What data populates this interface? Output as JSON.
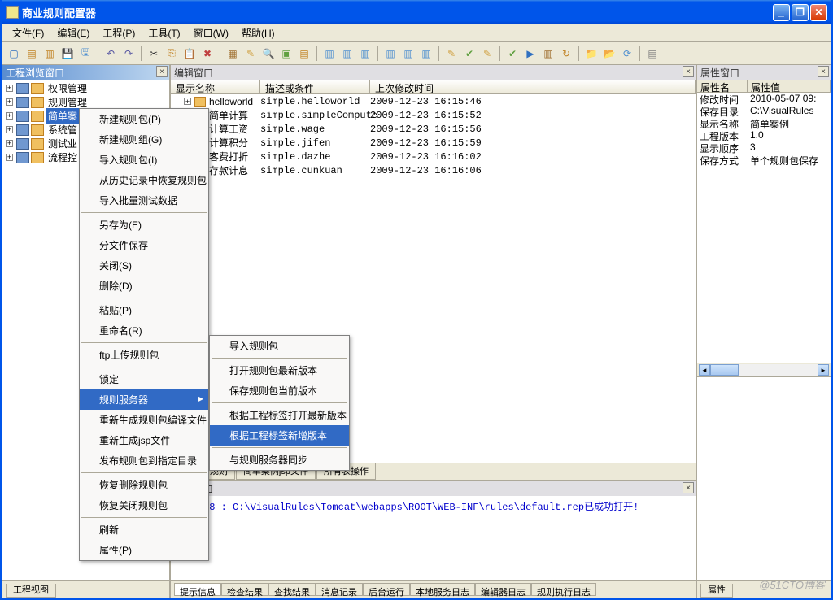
{
  "title": "商业规则配置器",
  "menu": [
    "文件(F)",
    "编辑(E)",
    "工程(P)",
    "工具(T)",
    "窗口(W)",
    "帮助(H)"
  ],
  "panels": {
    "left": "工程浏览窗口",
    "center": "编辑窗口",
    "right": "属性窗口",
    "msg": "消息窗口"
  },
  "tree": [
    {
      "label": "权限管理"
    },
    {
      "label": "规则管理"
    },
    {
      "label": "简单案",
      "selected": true
    },
    {
      "label": "系统管"
    },
    {
      "label": "测试业"
    },
    {
      "label": "流程控"
    }
  ],
  "table_cols": [
    "显示名称",
    "描述或条件",
    "上次修改时间"
  ],
  "table_rows": [
    {
      "name": "helloworld",
      "desc": "simple.helloworld",
      "time": "2009-12-23 16:15:46"
    },
    {
      "name": "简单计算",
      "desc": "simple.simpleCompute",
      "time": "2009-12-23 16:15:52"
    },
    {
      "name": "计算工资",
      "desc": "simple.wage",
      "time": "2009-12-23 16:15:56"
    },
    {
      "name": "计算积分",
      "desc": "simple.jifen",
      "time": "2009-12-23 16:15:59"
    },
    {
      "name": "客费打折",
      "desc": "simple.dazhe",
      "time": "2009-12-23 16:16:02"
    },
    {
      "name": "存款计息",
      "desc": "simple.cunkuan",
      "time": "2009-12-23 16:16:06"
    }
  ],
  "prop_cols": [
    "属性名",
    "属性值"
  ],
  "props": [
    {
      "n": "修改时间",
      "v": "2010-05-07 09:"
    },
    {
      "n": "保存目录",
      "v": "C:\\VisualRules"
    },
    {
      "n": "显示名称",
      "v": "简单案例"
    },
    {
      "n": "工程版本",
      "v": "1.0"
    },
    {
      "n": "显示顺序",
      "v": "3"
    },
    {
      "n": "保存方式",
      "v": "单个规则包保存"
    }
  ],
  "btabs": [
    "所有规则",
    "简单案例jsp文件",
    "所有表操作"
  ],
  "prop_btab": "属性",
  "left_btab": "工程视图",
  "msg_text": "9:11:28 : C:\\VisualRules\\Tomcat\\webapps\\ROOT\\WEB-INF\\rules\\default.rep已成功打开!",
  "msg_tabs": [
    "提示信息",
    "检查结果",
    "查找结果",
    "消息记录",
    "后台运行",
    "本地服务日志",
    "编辑器日志",
    "规则执行日志"
  ],
  "ctx1": [
    {
      "t": "新建规则包(P)"
    },
    {
      "t": "新建规则组(G)"
    },
    {
      "t": "导入规则包(I)"
    },
    {
      "t": "从历史记录中恢复规则包"
    },
    {
      "t": "导入批量测试数据"
    },
    "sep",
    {
      "t": "另存为(E)"
    },
    {
      "t": "分文件保存"
    },
    {
      "t": "关闭(S)"
    },
    {
      "t": "删除(D)"
    },
    "sep",
    {
      "t": "粘贴(P)"
    },
    {
      "t": "重命名(R)"
    },
    "sep",
    {
      "t": "ftp上传规则包"
    },
    "sep",
    {
      "t": "锁定"
    },
    {
      "t": "规则服务器",
      "arrow": true,
      "hover": true
    },
    {
      "t": "重新生成规则包编译文件"
    },
    {
      "t": "重新生成jsp文件"
    },
    {
      "t": "发布规则包到指定目录"
    },
    "sep",
    {
      "t": "恢复删除规则包"
    },
    {
      "t": "恢复关闭规则包"
    },
    "sep",
    {
      "t": "刷新"
    },
    {
      "t": "属性(P)"
    }
  ],
  "ctx2": [
    {
      "t": "导入规则包"
    },
    "sep",
    {
      "t": "打开规则包最新版本"
    },
    {
      "t": "保存规则包当前版本"
    },
    "sep",
    {
      "t": "根据工程标签打开最新版本"
    },
    {
      "t": "根据工程标签新增版本",
      "hover": true
    },
    "sep",
    {
      "t": "与规则服务器同步"
    }
  ],
  "watermark": "@51CTO博客"
}
